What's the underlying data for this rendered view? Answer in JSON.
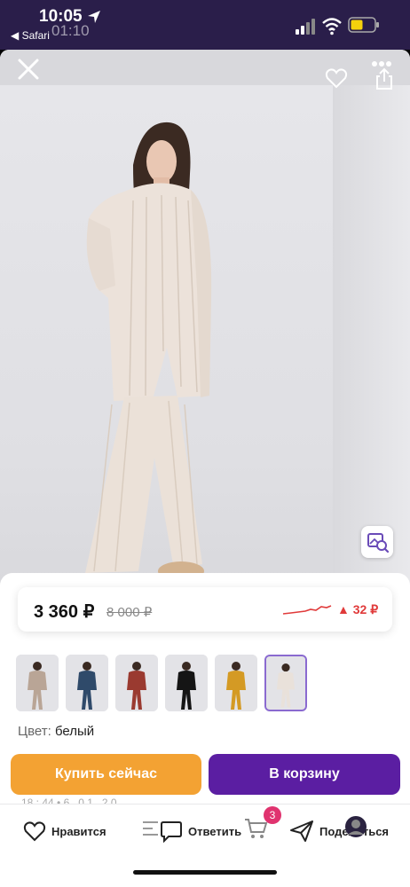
{
  "status_bar": {
    "time": "10:05",
    "back_app": "◀ Safari",
    "overlay_time": "01:10",
    "icons": [
      "location-arrow-icon",
      "cellular-signal-icon",
      "wifi-icon",
      "battery-icon"
    ]
  },
  "header": {
    "icons": [
      "close-icon",
      "heart-icon",
      "more-icon",
      "share-icon"
    ]
  },
  "product": {
    "price": "3 360 ₽",
    "old_price": "8 000 ₽",
    "price_change": "▲ 32 ₽",
    "color_label": "Цвет:",
    "color_value": "белый",
    "variants": [
      {
        "color": "#b9a596",
        "selected": false
      },
      {
        "color": "#2f4a6a",
        "selected": false
      },
      {
        "color": "#9a3a30",
        "selected": false
      },
      {
        "color": "#151515",
        "selected": false
      },
      {
        "color": "#d49a24",
        "selected": false
      },
      {
        "color": "#e9e1da",
        "selected": true
      }
    ],
    "peek_text": "18 : 44   •   6 . 0 1 . 2 0"
  },
  "actions": {
    "buy_now": "Купить сейчас",
    "add_to_cart": "В корзину"
  },
  "bottom_bar": {
    "like": "Нравится",
    "reply": "Ответить",
    "cart_count": "3",
    "share": "Поделиться"
  },
  "colors": {
    "accent_purple": "#5b1ea2",
    "accent_orange": "#f3a233",
    "price_up_red": "#e03a3a",
    "status_bar_bg": "#2a1e4a"
  }
}
